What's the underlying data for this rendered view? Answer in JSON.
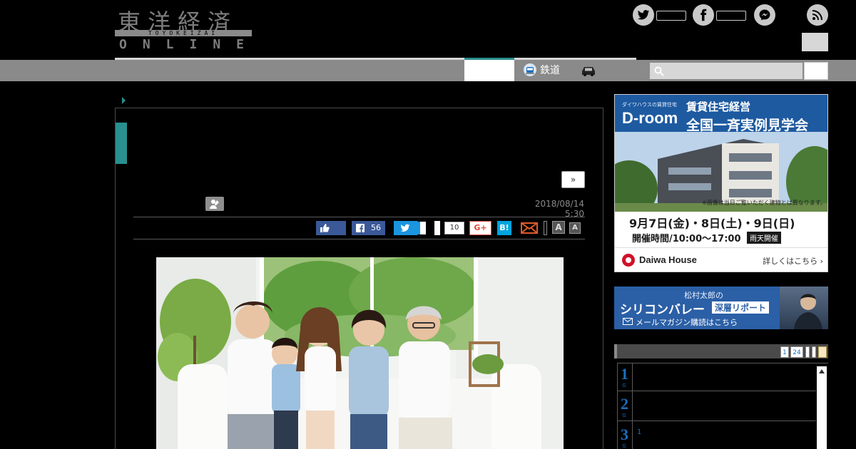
{
  "header": {
    "logo_kanji": "東洋経済",
    "logo_roman": "TOYOKEIZAI",
    "logo_online": "ONLINE"
  },
  "nav": {
    "rail_label": "鉄道",
    "search_placeholder": ""
  },
  "article": {
    "next_label": "»",
    "date": "2018/08/14 5:30",
    "share": {
      "facebook_count": "56",
      "pocket_count": "10",
      "google_plus": "G+",
      "hatena": "B!",
      "font_large": "A",
      "font_small": "A"
    }
  },
  "sidebar": {
    "ad_droom": {
      "tagline": "ダイワハウスの賃貸住宅",
      "logo": "D-room",
      "heading1": "賃貸住宅経営",
      "heading2": "全国一斉実例見学会",
      "note": "※画像は当日ご覧いただく建物とは異なります。",
      "dates": "9月7日(金)・8日(土)・9日(日)",
      "hours": "開催時間/10:00〜17:00",
      "rain": "雨天開催",
      "brand": "Daiwa House",
      "more": "詳しくはこちら ›"
    },
    "ad_silicon": {
      "subtitle": "松村太郎の",
      "title": "シリコンバレー",
      "badge": "深層リポート",
      "cta": "メールマガジン購読はこちら"
    },
    "ranking": {
      "tab1": "1",
      "tab2": "24",
      "tab3": "",
      "tab4": "",
      "tab5": "",
      "rows": [
        {
          "num": "1",
          "unit": "位",
          "text": ""
        },
        {
          "num": "2",
          "unit": "位",
          "text": ""
        },
        {
          "num": "3",
          "unit": "位",
          "text": "1"
        }
      ]
    }
  },
  "colors": {
    "accent_teal": "#2a8f8f",
    "nav_gray": "#8a8a8a",
    "ranking_blue": "#1a6fc0"
  }
}
